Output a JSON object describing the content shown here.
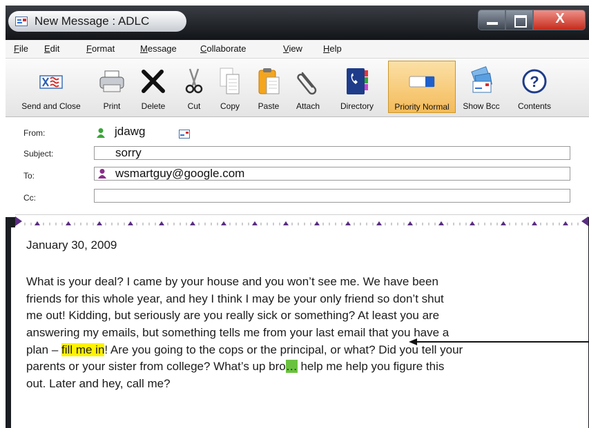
{
  "window": {
    "title": "New Message : ADLC",
    "close_glyph": "X"
  },
  "menu": [
    "File",
    "Edit",
    "Format",
    "Message",
    "Collaborate",
    "View",
    "Help"
  ],
  "toolbar": [
    {
      "label": "Send and Close",
      "icon": "send-and-close-icon"
    },
    {
      "label": "Print",
      "icon": "printer-icon"
    },
    {
      "label": "Delete",
      "icon": "delete-x-icon"
    },
    {
      "label": "Cut",
      "icon": "scissors-icon"
    },
    {
      "label": "Copy",
      "icon": "copy-pages-icon"
    },
    {
      "label": "Paste",
      "icon": "clipboard-icon"
    },
    {
      "label": "Attach",
      "icon": "paperclip-icon"
    },
    {
      "label": "Directory",
      "icon": "phone-book-icon"
    },
    {
      "label": "Priority Normal",
      "icon": "priority-toggle-icon",
      "active": true
    },
    {
      "label": "Show Bcc",
      "icon": "show-bcc-icon"
    },
    {
      "label": "Contents",
      "icon": "help-question-icon"
    }
  ],
  "headers": {
    "from_label": "From:",
    "from_value": "jdawg",
    "subject_label": "Subject:",
    "subject_value": "sorry",
    "to_label": "To:",
    "to_value": "wsmartguy@google.com",
    "cc_label": "Cc:",
    "cc_value": ""
  },
  "message": {
    "date": "January 30, 2009",
    "line1": "What is your deal? I came by your house and you won’t see me. We have been",
    "line2": "friends for this whole year, and hey I think I may be your only friend so don’t shut",
    "line3": "me out! Kidding, but seriously are you really sick or something? At least you are",
    "line4": "answering my emails, but something tells me from your last email that you have a",
    "line5_before": "plan – ",
    "line5_highlight": "fill me in",
    "line5_after": "! Are you going to the cops or the principal, or what? Did you tell your",
    "line6_before": "parents or your sister from college? What’s up bro",
    "line6_highlight": "…",
    "line6_after": " help me help you figure this",
    "line7": "out. Later and hey, call me?"
  },
  "colors": {
    "highlight_yellow": "#fff200",
    "highlight_green": "#6ac13f",
    "active_button": "#f4bb5a",
    "ruler_marker": "#5a2d82"
  }
}
